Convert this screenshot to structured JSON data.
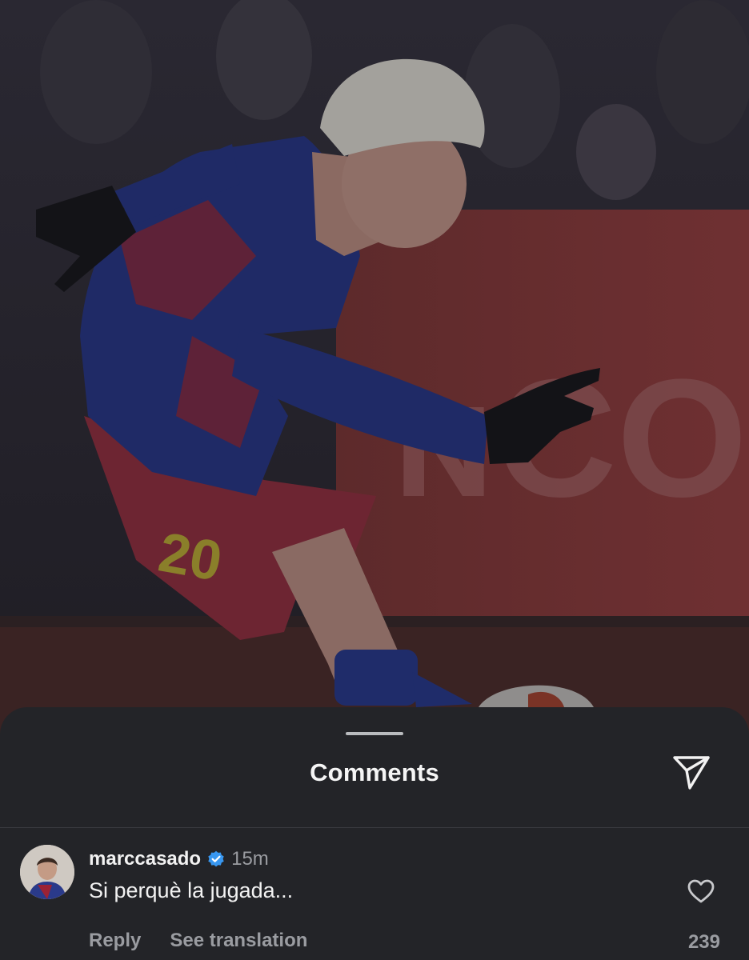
{
  "sheet": {
    "title": "Comments"
  },
  "comment": {
    "username": "marccasado",
    "time": "15m",
    "text": "Si perquè la jugada...",
    "reply_label": "Reply",
    "translate_label": "See translation",
    "likes": "239"
  },
  "icons": {
    "share": "paper-plane-icon",
    "verified": "verified-badge-icon",
    "like": "heart-outline-icon"
  },
  "colors": {
    "sheet_bg": "#232428",
    "verified_blue": "#3897f0",
    "secondary_text": "#9a9ca1"
  }
}
